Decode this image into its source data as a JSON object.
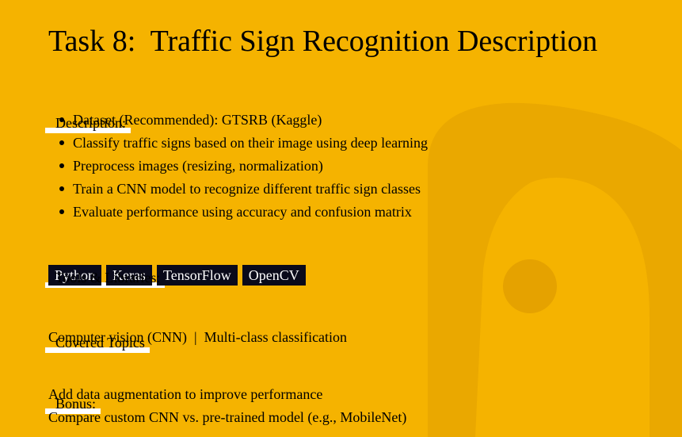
{
  "title": "Task 8:  Traffic Sign Recognition Description",
  "description": {
    "label": "Description:",
    "bullets": [
      "Dataset (Recommended): GTSRB (Kaggle)",
      "Classify traffic signs based on their image using deep learning",
      "Preprocess images (resizing, normalization)",
      "Train a CNN model to recognize different traffic sign classes",
      "Evaluate performance using accuracy and confusion matrix"
    ]
  },
  "tools": {
    "label": "Tools & Libraries:",
    "tags": [
      "Python",
      "Keras",
      "TensorFlow",
      "OpenCV"
    ]
  },
  "topics": {
    "label": "Covered Topics",
    "text": "Computer vision (CNN)  |  Multi-class classification"
  },
  "bonus": {
    "label": "Bonus:",
    "lines": [
      "Add data augmentation to improve performance",
      "Compare custom CNN vs. pre-trained model (e.g., MobileNet)"
    ]
  },
  "colors": {
    "background": "#F5B300",
    "tag_background": "#0A0A1A",
    "highlight": "#FFFFFF",
    "watermark": "#E5A200"
  }
}
